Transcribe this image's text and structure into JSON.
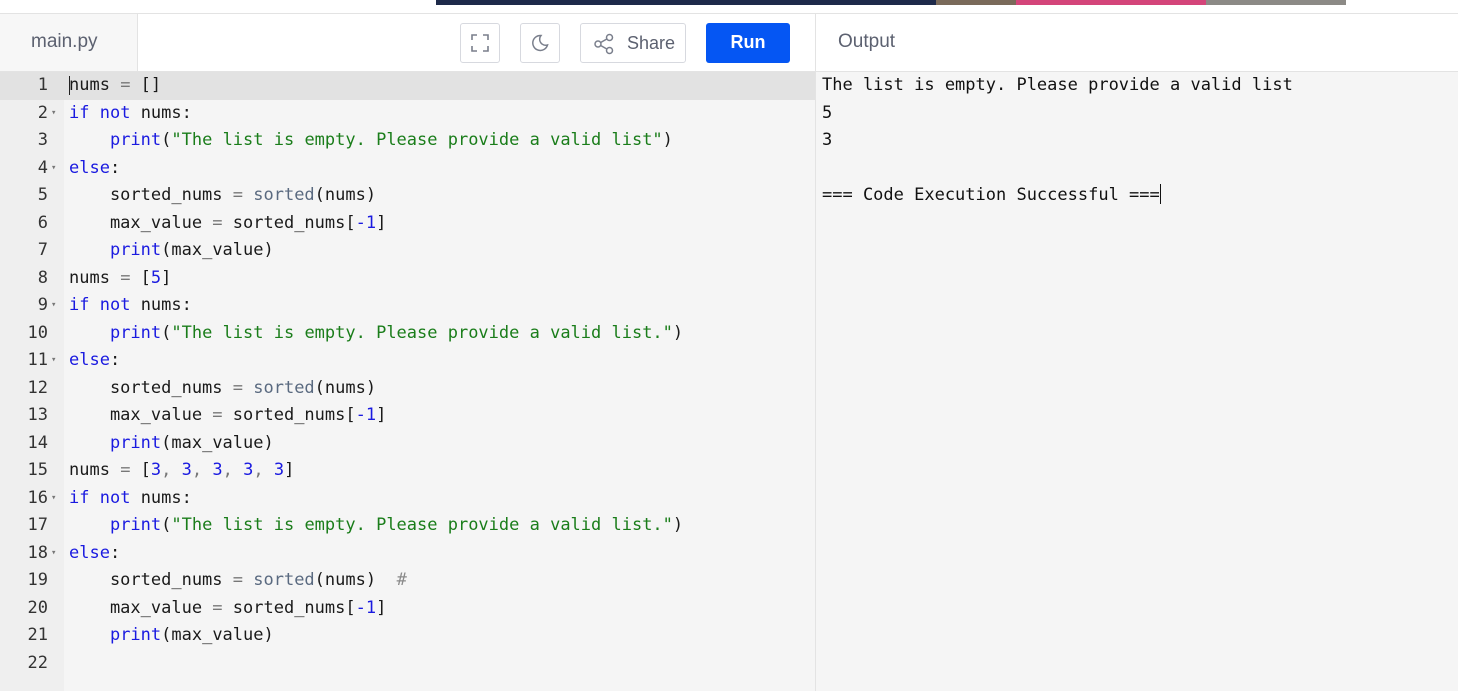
{
  "editor": {
    "filename": "main.py",
    "share_label": "Share",
    "run_label": "Run",
    "icons": [
      "fullscreen-icon",
      "moon-icon",
      "share-icon"
    ],
    "accent_color": "#0556f3",
    "active_line": 1,
    "lines": [
      {
        "n": "1",
        "fold": false,
        "tokens": [
          [
            "nums",
            "id"
          ],
          [
            " = ",
            "op"
          ],
          [
            "[]",
            "id"
          ]
        ]
      },
      {
        "n": "2",
        "fold": true,
        "tokens": [
          [
            "if",
            "kw"
          ],
          [
            " ",
            "id"
          ],
          [
            "not",
            "kw"
          ],
          [
            " nums:",
            "id"
          ]
        ]
      },
      {
        "n": "3",
        "fold": false,
        "tokens": [
          [
            "    ",
            "id"
          ],
          [
            "print",
            "fn"
          ],
          [
            "(",
            "id"
          ],
          [
            "\"The list is empty. Please provide a valid list\"",
            "str"
          ],
          [
            ")",
            "id"
          ]
        ]
      },
      {
        "n": "4",
        "fold": true,
        "tokens": [
          [
            "else",
            "kw"
          ],
          [
            ":",
            "id"
          ]
        ]
      },
      {
        "n": "5",
        "fold": false,
        "tokens": [
          [
            "    sorted_nums",
            "id"
          ],
          [
            " = ",
            "op"
          ],
          [
            "sorted",
            "bi"
          ],
          [
            "(nums)",
            "id"
          ]
        ]
      },
      {
        "n": "6",
        "fold": false,
        "tokens": [
          [
            "    max_value",
            "id"
          ],
          [
            " = ",
            "op"
          ],
          [
            "sorted_nums[",
            "id"
          ],
          [
            "-1",
            "num"
          ],
          [
            "]",
            "id"
          ]
        ]
      },
      {
        "n": "7",
        "fold": false,
        "tokens": [
          [
            "    ",
            "id"
          ],
          [
            "print",
            "fn"
          ],
          [
            "(max_value)",
            "id"
          ]
        ]
      },
      {
        "n": "8",
        "fold": false,
        "tokens": [
          [
            "nums",
            "id"
          ],
          [
            " = ",
            "op"
          ],
          [
            "[",
            "id"
          ],
          [
            "5",
            "num"
          ],
          [
            "]",
            "id"
          ]
        ]
      },
      {
        "n": "9",
        "fold": true,
        "tokens": [
          [
            "if",
            "kw"
          ],
          [
            " ",
            "id"
          ],
          [
            "not",
            "kw"
          ],
          [
            " nums:",
            "id"
          ]
        ]
      },
      {
        "n": "10",
        "fold": false,
        "tokens": [
          [
            "    ",
            "id"
          ],
          [
            "print",
            "fn"
          ],
          [
            "(",
            "id"
          ],
          [
            "\"The list is empty. Please provide a valid list.\"",
            "str"
          ],
          [
            ")",
            "id"
          ]
        ]
      },
      {
        "n": "11",
        "fold": true,
        "tokens": [
          [
            "else",
            "kw"
          ],
          [
            ":",
            "id"
          ]
        ]
      },
      {
        "n": "12",
        "fold": false,
        "tokens": [
          [
            "    sorted_nums",
            "id"
          ],
          [
            " = ",
            "op"
          ],
          [
            "sorted",
            "bi"
          ],
          [
            "(nums)",
            "id"
          ]
        ]
      },
      {
        "n": "13",
        "fold": false,
        "tokens": [
          [
            "    max_value",
            "id"
          ],
          [
            " = ",
            "op"
          ],
          [
            "sorted_nums[",
            "id"
          ],
          [
            "-1",
            "num"
          ],
          [
            "]",
            "id"
          ]
        ]
      },
      {
        "n": "14",
        "fold": false,
        "tokens": [
          [
            "    ",
            "id"
          ],
          [
            "print",
            "fn"
          ],
          [
            "(max_value)",
            "id"
          ]
        ]
      },
      {
        "n": "15",
        "fold": false,
        "tokens": [
          [
            "nums",
            "id"
          ],
          [
            " = ",
            "op"
          ],
          [
            "[",
            "id"
          ],
          [
            "3",
            "num"
          ],
          [
            ", ",
            "op"
          ],
          [
            "3",
            "num"
          ],
          [
            ", ",
            "op"
          ],
          [
            "3",
            "num"
          ],
          [
            ", ",
            "op"
          ],
          [
            "3",
            "num"
          ],
          [
            ", ",
            "op"
          ],
          [
            "3",
            "num"
          ],
          [
            "]",
            "id"
          ]
        ]
      },
      {
        "n": "16",
        "fold": true,
        "tokens": [
          [
            "if",
            "kw"
          ],
          [
            " ",
            "id"
          ],
          [
            "not",
            "kw"
          ],
          [
            " nums:",
            "id"
          ]
        ]
      },
      {
        "n": "17",
        "fold": false,
        "tokens": [
          [
            "    ",
            "id"
          ],
          [
            "print",
            "fn"
          ],
          [
            "(",
            "id"
          ],
          [
            "\"The list is empty. Please provide a valid list.\"",
            "str"
          ],
          [
            ")",
            "id"
          ]
        ]
      },
      {
        "n": "18",
        "fold": true,
        "tokens": [
          [
            "else",
            "kw"
          ],
          [
            ":",
            "id"
          ]
        ]
      },
      {
        "n": "19",
        "fold": false,
        "tokens": [
          [
            "    sorted_nums",
            "id"
          ],
          [
            " = ",
            "op"
          ],
          [
            "sorted",
            "bi"
          ],
          [
            "(nums)  ",
            "id"
          ],
          [
            "#",
            "cm"
          ]
        ]
      },
      {
        "n": "20",
        "fold": false,
        "tokens": [
          [
            "    max_value",
            "id"
          ],
          [
            " = ",
            "op"
          ],
          [
            "sorted_nums[",
            "id"
          ],
          [
            "-1",
            "num"
          ],
          [
            "]",
            "id"
          ]
        ]
      },
      {
        "n": "21",
        "fold": false,
        "tokens": [
          [
            "    ",
            "id"
          ],
          [
            "print",
            "fn"
          ],
          [
            "(max_value)",
            "id"
          ]
        ]
      },
      {
        "n": "22",
        "fold": false,
        "tokens": []
      }
    ]
  },
  "output": {
    "title": "Output",
    "lines": [
      "The list is empty. Please provide a valid list",
      "5",
      "3",
      "",
      "=== Code Execution Successful ==="
    ]
  }
}
